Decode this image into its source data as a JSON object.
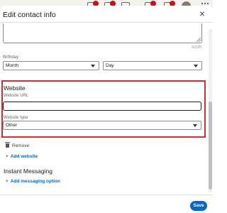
{
  "nav": {
    "icons": [
      "home-icon",
      "network-icon",
      "jobs-icon",
      "messaging-icon",
      "notifications-icon",
      "profile-icon",
      "grid-icon"
    ]
  },
  "modal": {
    "title": "Edit contact info",
    "close_symbol": "×",
    "char_count": "0/220",
    "birthday": {
      "label": "Birthday",
      "month_value": "Month",
      "day_value": "Day"
    },
    "website": {
      "section_title": "Website",
      "url_label": "Website URL",
      "url_value": "",
      "type_label": "Website type",
      "type_value": "Other",
      "remove_label": "Remove",
      "add_label": "Add website"
    },
    "instant_messaging": {
      "section_title": "Instant Messaging",
      "add_label": "Add messaging option"
    },
    "save_label": "Save"
  },
  "colors": {
    "accent": "#0a66c2",
    "highlight": "#d32f2f",
    "badge": "#cc1016"
  }
}
